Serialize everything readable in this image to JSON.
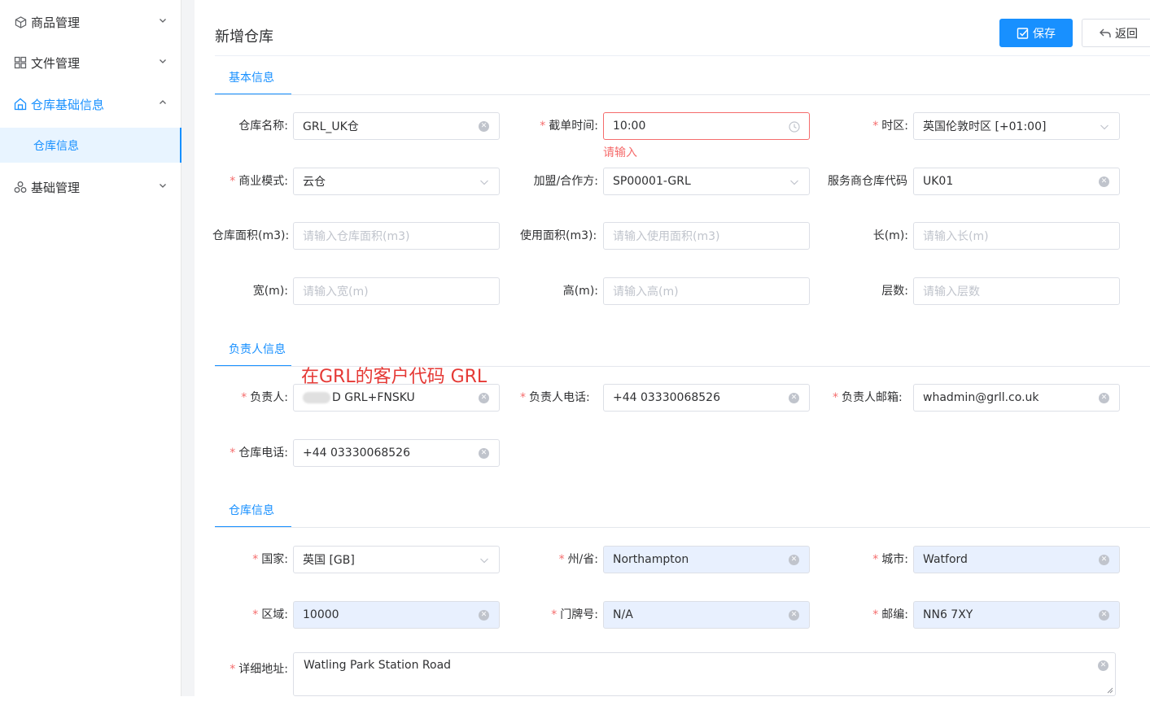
{
  "sidebar": {
    "items": [
      {
        "label": "商品管理",
        "icon": "box-icon"
      },
      {
        "label": "文件管理",
        "icon": "grid-icon"
      },
      {
        "label": "仓库基础信息",
        "icon": "warehouse-icon"
      },
      {
        "label": "基础管理",
        "icon": "cluster-icon"
      }
    ],
    "sub_item": "仓库信息"
  },
  "header": {
    "title": "新增仓库",
    "save_label": "保存",
    "back_label": "返回"
  },
  "sections": {
    "basic": "基本信息",
    "contact": "负责人信息",
    "warehouse": "仓库信息"
  },
  "form": {
    "warehouse_name": {
      "label": "仓库名称:",
      "value": "GRL_UK仓"
    },
    "cutoff_time": {
      "label": "截单时间:",
      "value": "10:00",
      "error": "请输入"
    },
    "timezone": {
      "label": "时区:",
      "value": "英国伦敦时区 [+01:00]"
    },
    "business_mode": {
      "label": "商业模式:",
      "value": "云仓"
    },
    "partner": {
      "label": "加盟/合作方:",
      "value": "SP00001-GRL"
    },
    "service_code": {
      "label": "服务商仓库代码",
      "value": "UK01"
    },
    "area": {
      "label": "仓库面积(m3):",
      "placeholder": "请输入仓库面积(m3)"
    },
    "used_area": {
      "label": "使用面积(m3):",
      "placeholder": "请输入使用面积(m3)"
    },
    "length": {
      "label": "长(m):",
      "placeholder": "请输入长(m)"
    },
    "width": {
      "label": "宽(m):",
      "placeholder": "请输入宽(m)"
    },
    "height": {
      "label": "高(m):",
      "placeholder": "请输入高(m)"
    },
    "floors": {
      "label": "层数:",
      "placeholder": "请输入层数"
    },
    "manager": {
      "label": "负责人:",
      "value": "D GRL+FNSKU"
    },
    "manager_phone": {
      "label": "负责人电话:",
      "value": "+44 03330068526"
    },
    "manager_email": {
      "label": "负责人邮箱:",
      "value": "whadmin@grll.co.uk"
    },
    "warehouse_phone": {
      "label": "仓库电话:",
      "value": "+44 03330068526"
    },
    "country": {
      "label": "国家:",
      "value": "英国 [GB]"
    },
    "state": {
      "label": "州/省:",
      "value": "Northampton"
    },
    "city": {
      "label": "城市:",
      "value": "Watford"
    },
    "district": {
      "label": "区域:",
      "value": "10000"
    },
    "house_no": {
      "label": "门牌号:",
      "value": "N/A"
    },
    "postcode": {
      "label": "邮编:",
      "value": "NN6 7XY"
    },
    "address": {
      "label": "详细地址:",
      "value": "Watling Park Station Road"
    }
  },
  "annotation": "在GRL的客户代码 GRL",
  "colors": {
    "primary": "#1890ff",
    "danger": "#f56c6c",
    "autofill": "#e8f0fe"
  }
}
